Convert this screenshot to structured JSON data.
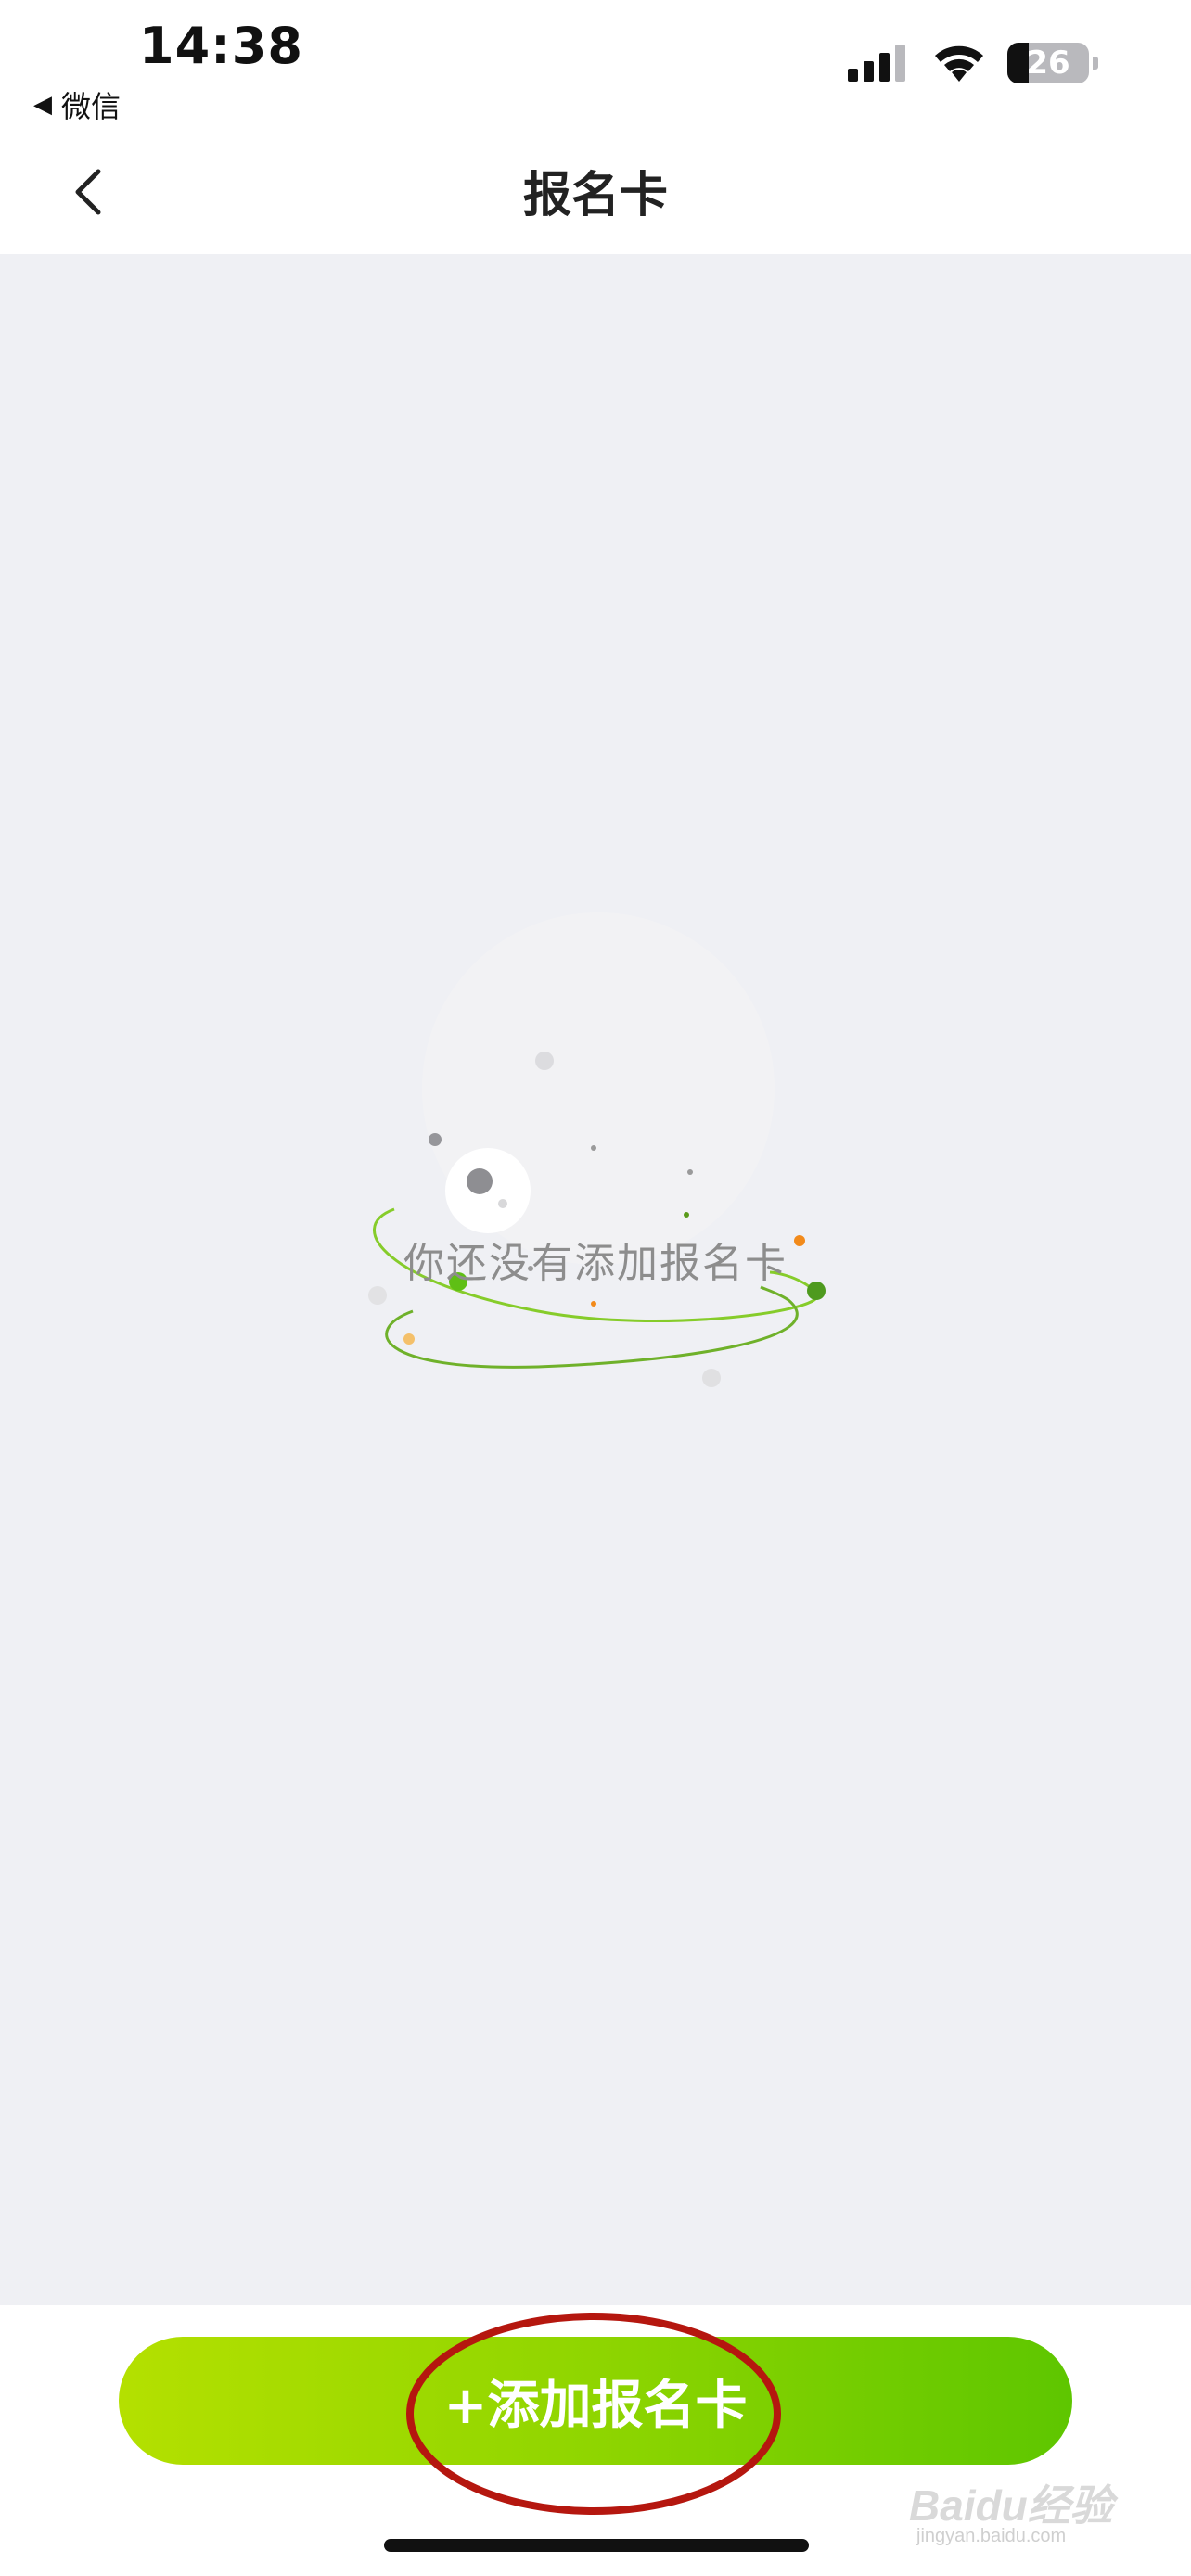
{
  "status_bar": {
    "time": "14:38",
    "back_app_label": "微信",
    "battery_level": "26",
    "icons": [
      "signal-icon",
      "wifi-icon",
      "battery-icon"
    ]
  },
  "nav": {
    "title": "报名卡",
    "back_icon": "chevron-left-icon"
  },
  "empty_state": {
    "message": "你还没有添加报名卡",
    "illustration": "planet-orbit-illustration"
  },
  "bottom": {
    "add_button_label": "+添加报名卡"
  },
  "watermark": {
    "brand": "Baidu经验",
    "url": "jingyan.baidu.com"
  },
  "colors": {
    "accent_start": "#b4e000",
    "accent_end": "#5ec600",
    "background": "#eff0f4",
    "annotation": "#b5170f"
  }
}
